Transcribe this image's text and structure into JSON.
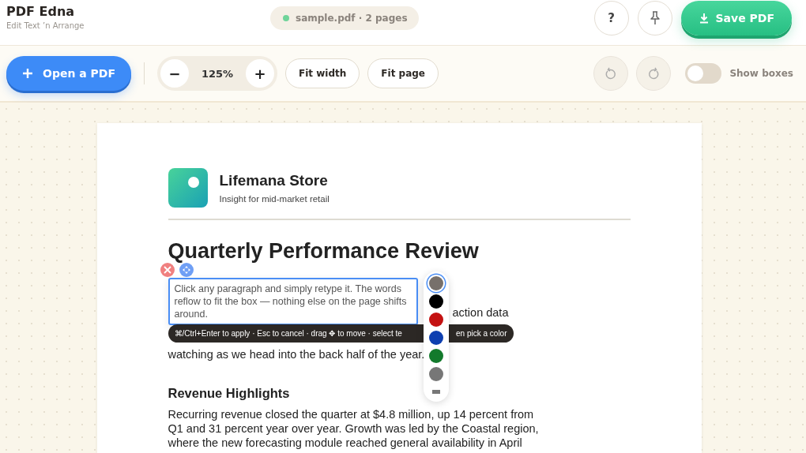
{
  "app": {
    "title": "PDF Edna",
    "subtitle": "Edit Text ’n Arrange"
  },
  "file": {
    "label": "sample.pdf · 2 pages",
    "status_dot": {
      "color": "#6fd49a"
    }
  },
  "header_buttons": [
    {
      "kind": "help",
      "label": "?"
    },
    {
      "kind": "pin"
    }
  ],
  "save_button": {
    "label": "Save PDF"
  },
  "toolbar": {
    "open_label": "Open a PDF",
    "zoom_out": "−",
    "zoom": "125%",
    "zoom_in": "+",
    "fit_width": "Fit width",
    "fit_page": "Fit page",
    "undo_disabled": true,
    "redo_disabled": true,
    "show_boxes": {
      "label": "Show boxes",
      "on": false
    }
  },
  "document": {
    "brand": "Lifemana Store",
    "tagline": "Insight for mid-market retail",
    "heading": "Quarterly Performance Review",
    "intro_lines": [
      "action data",
      "watching as we head into the back half of the year."
    ],
    "section_heading": "Revenue Highlights",
    "section_text": "Recurring revenue closed the quarter at $4.8 million, up 14 percent from Q1 and 31 percent year over year. Growth was led by the Coastal region, where the new forecasting module reached general availability in April"
  },
  "editor": {
    "text": "Click any paragraph and simply retype it. The words reflow to fit the box — nothing else on the page shifts around.",
    "hint": "⌘/Ctrl+Enter to apply · Esc to cancel · drag ✥ to move · select te",
    "hint_end": "en pick a color"
  },
  "palette": [
    {
      "color": "#77706b",
      "selected": true
    },
    {
      "color": "#000000",
      "selected": false
    },
    {
      "color": "#c41212",
      "selected": false
    },
    {
      "color": "#0e3fb0",
      "selected": false
    },
    {
      "color": "#137a2c",
      "selected": false
    },
    {
      "color": "#777777",
      "selected": false
    }
  ]
}
